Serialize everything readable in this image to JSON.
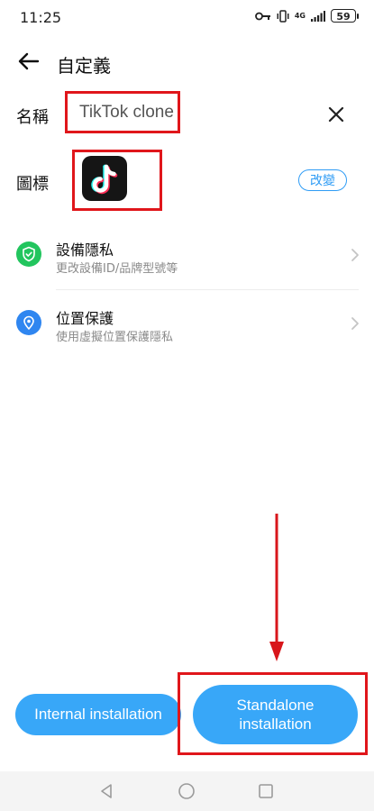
{
  "status_bar": {
    "time": "11:25",
    "network": "4G",
    "battery": "59"
  },
  "header": {
    "title": "自定義"
  },
  "name_row": {
    "label": "名稱",
    "value": "TikTok clone"
  },
  "icon_row": {
    "label": "圖標",
    "change_label": "改變"
  },
  "settings": [
    {
      "title": "設備隱私",
      "subtitle": "更改設備ID/品牌型號等"
    },
    {
      "title": "位置保護",
      "subtitle": "使用虛擬位置保護隱私"
    }
  ],
  "buttons": {
    "internal": "Internal installation",
    "standalone": "Standalone installation"
  },
  "colors": {
    "accent": "#38a7f8",
    "highlight": "#e0161b",
    "privacy_icon": "#22c55e",
    "location_icon": "#2f86f0"
  }
}
